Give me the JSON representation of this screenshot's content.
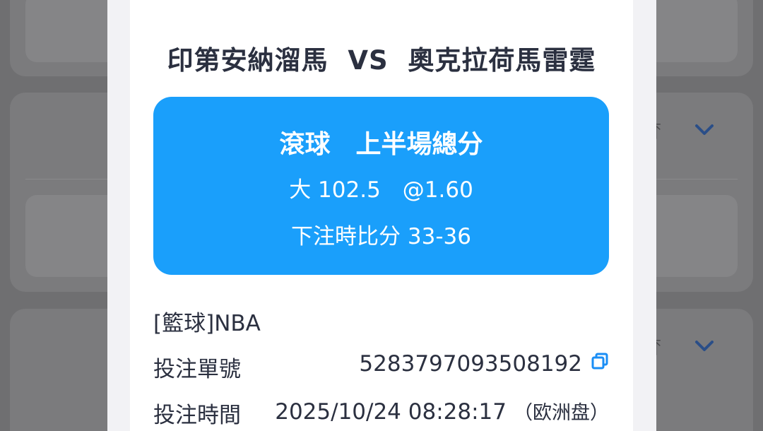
{
  "match": {
    "home_team": "印第安納溜馬",
    "vs_label": "VS",
    "away_team": "奧克拉荷馬雷霆"
  },
  "bet": {
    "type_label": "滾球　上半場總分",
    "pick_label": "大 102.5　@1.60",
    "score_label": "下注時比分 33-36"
  },
  "details": {
    "league": "[籃球]NBA",
    "order_label": "投注單號",
    "order_value": "5283797093508192",
    "time_label": "投注時間",
    "time_value": "2025/10/24 08:28:17",
    "market_note": "（欧洲盘）"
  },
  "colors": {
    "accent": "#1a9ffb",
    "text": "#2b3040",
    "background_dim": "#6f6f71"
  },
  "icons": {
    "copy": "copy-icon",
    "scroll_top": "arrow-up-icon",
    "expand": "chevron-down-icon"
  }
}
